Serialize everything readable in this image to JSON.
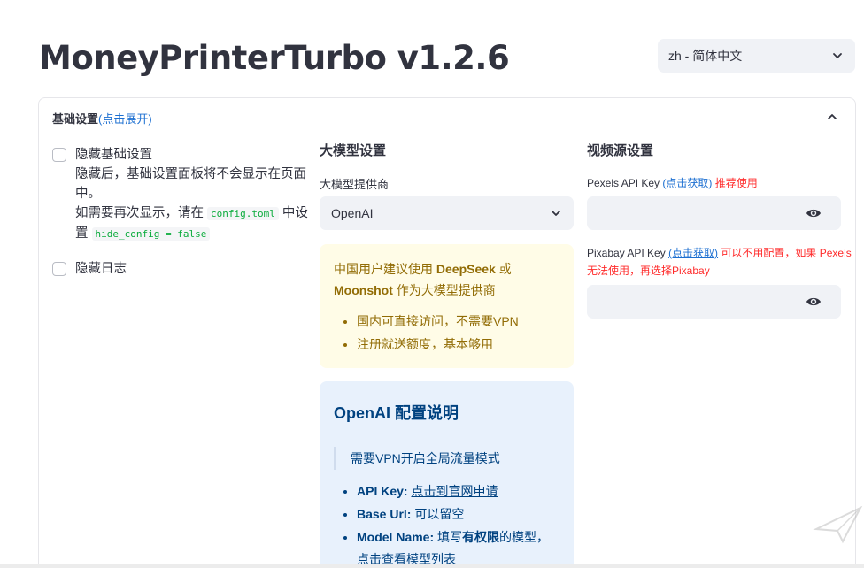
{
  "app": {
    "title": "MoneyPrinterTurbo v1.2.6"
  },
  "language": {
    "selected": "zh - 简体中文"
  },
  "expander": {
    "title_bold": "基础设置",
    "title_hint": "(点击展开)"
  },
  "left": {
    "hide_basic": {
      "label": "隐藏基础设置"
    },
    "help": {
      "line1": "隐藏后，基础设置面板将不会显示在页面中。",
      "line2_pre": "如需要再次显示，请在 ",
      "line2_code": "config.toml",
      "line2_post": " 中设置 ",
      "line2_code2": "hide_config = false"
    },
    "hide_log": {
      "label": "隐藏日志"
    }
  },
  "llm": {
    "heading": "大模型设置",
    "provider_label": "大模型提供商",
    "provider_value": "OpenAI",
    "warning": {
      "pre": "中国用户建议使用 ",
      "b1": "DeepSeek",
      "mid": " 或 ",
      "b2": "Moonshot",
      "post": " 作为大模型提供商",
      "items": [
        "国内可直接访问，不需要VPN",
        "注册就送额度，基本够用"
      ]
    },
    "info": {
      "title": "OpenAI 配置说明",
      "quote": "需要VPN开启全局流量模式",
      "api_key_label": "API Key:",
      "api_key_link": "点击到官网申请",
      "base_url_label": "Base Url:",
      "base_url_text": "可以留空",
      "model_label": "Model Name:",
      "model_text_pre": "填写",
      "model_text_bold": "有权限",
      "model_text_post": "的模型，",
      "model_link": "点击查看模型列表"
    }
  },
  "video_source": {
    "heading": "视频源设置",
    "pexels": {
      "label": "Pexels API Key",
      "link": "(点击获取)",
      "note": "推荐使用"
    },
    "pixabay": {
      "label": "Pixabay API Key",
      "link": "(点击获取)",
      "note": "可以不用配置，如果 Pexels 无法使用，再选择Pixabay"
    }
  },
  "icons": {
    "chevron": "chevron-down-icon",
    "collapse": "chevron-up-icon",
    "eye": "eye-icon",
    "watermark": "watermark-icon"
  },
  "colors": {
    "accent_blue": "#1c6fd1",
    "red": "#ff2b2b",
    "warning_bg": "#fffce7",
    "warning_text": "#926c05",
    "info_bg": "#e8f1fc",
    "info_text": "#004280",
    "input_bg": "#f0f2f6"
  }
}
